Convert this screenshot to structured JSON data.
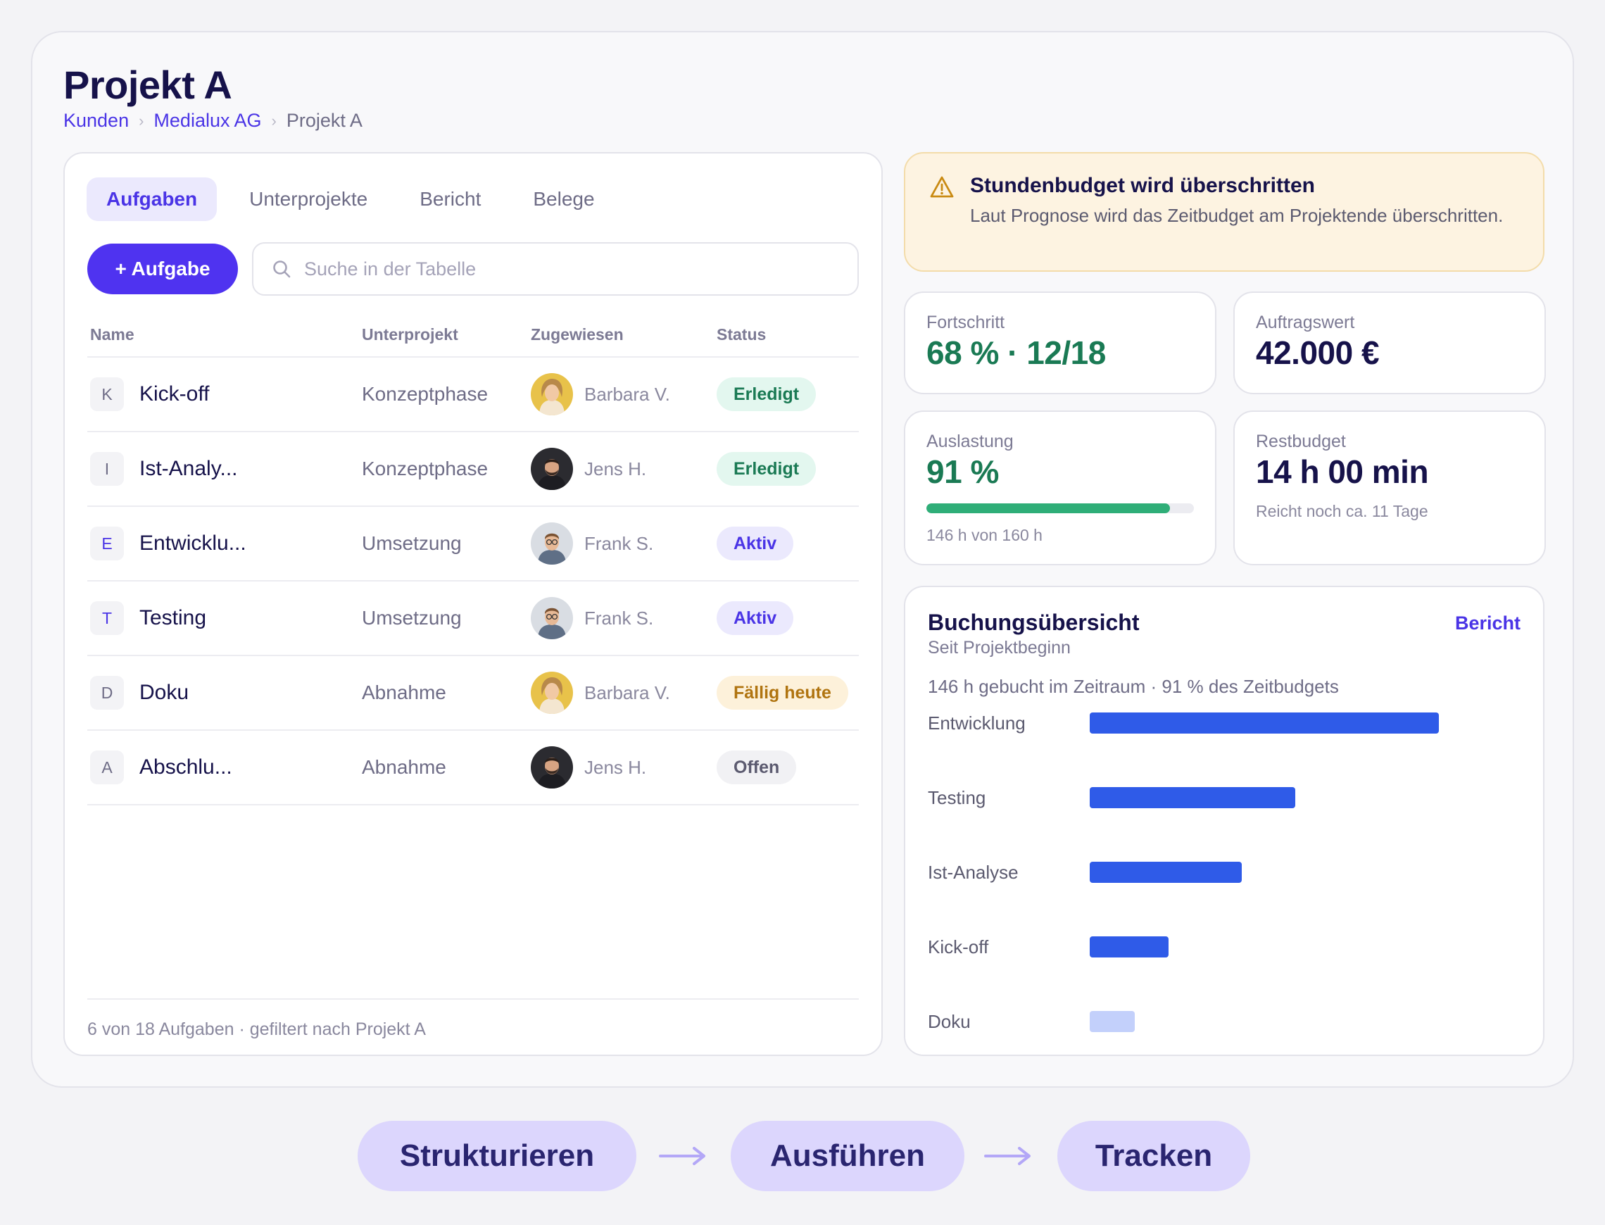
{
  "header": {
    "title": "Projekt A",
    "breadcrumb": [
      "Kunden",
      "Medialux AG",
      "Projekt A"
    ],
    "separator": "›"
  },
  "tabs": [
    "Aufgaben",
    "Unterprojekte",
    "Bericht",
    "Belege"
  ],
  "toolbar": {
    "add_label": "+ Aufgabe",
    "search_placeholder": "Suche in der Tabelle"
  },
  "table": {
    "columns": [
      "Name",
      "Unterprojekt",
      "Zugewiesen",
      "Status"
    ],
    "rows": [
      {
        "initial": "K",
        "name": "Kick-off",
        "subproject": "Konzeptphase",
        "assignee": "Barbara V.",
        "avatar": "barbara-avatar",
        "status": "Erledigt",
        "status_kind": "done"
      },
      {
        "initial": "I",
        "name": "Ist-Analy...",
        "subproject": "Konzeptphase",
        "assignee": "Jens H.",
        "avatar": "jens-avatar",
        "status": "Erledigt",
        "status_kind": "done"
      },
      {
        "initial": "E",
        "name": "Entwicklu...",
        "subproject": "Umsetzung",
        "assignee": "Frank S.",
        "avatar": "frank-avatar",
        "status": "Aktiv",
        "status_kind": "active"
      },
      {
        "initial": "T",
        "name": "Testing",
        "subproject": "Umsetzung",
        "assignee": "Frank S.",
        "avatar": "frank-avatar",
        "status": "Aktiv",
        "status_kind": "active"
      },
      {
        "initial": "D",
        "name": "Doku",
        "subproject": "Abnahme",
        "assignee": "Barbara V.",
        "avatar": "barbara-avatar",
        "status": "Fällig heute",
        "status_kind": "due"
      },
      {
        "initial": "A",
        "name": "Abschlu...",
        "subproject": "Abnahme",
        "assignee": "Jens H.",
        "avatar": "jens-avatar",
        "status": "Offen",
        "status_kind": "open"
      }
    ],
    "footer": "6 von 18 Aufgaben · gefiltert nach Projekt A"
  },
  "alert": {
    "icon": "warning-icon",
    "title": "Stundenbudget wird überschritten",
    "text": "Laut Prognose wird das Zeitbudget am Projektende überschritten."
  },
  "kpis": {
    "progress": {
      "label": "Fortschritt",
      "value": "68 % · 12/18"
    },
    "order_value": {
      "label": "Auftragswert",
      "value": "42.000 €"
    },
    "utilization": {
      "label": "Auslastung",
      "value": "91 %",
      "fill": 0.91,
      "note": "146 h von 160 h"
    },
    "remaining": {
      "label": "Restbudget",
      "value": "14 h 00 min",
      "note": "Reicht noch ca. 11 Tage"
    }
  },
  "booking": {
    "title": "Buchungsübersicht",
    "link": "Bericht",
    "subtitle": "Seit Projektbeginn",
    "summary": "146 h gebucht im Zeitraum · 91 % des Zeitbudgets"
  },
  "chart_data": {
    "type": "bar",
    "orientation": "horizontal",
    "categories": [
      "Entwicklung",
      "Testing",
      "Ist-Analyse",
      "Kick-off",
      "Doku"
    ],
    "values": [
      62,
      36.5,
      27,
      14,
      8
    ],
    "colors": [
      "#2f5be8",
      "#2f5be8",
      "#2f5be8",
      "#2f5be8",
      "#c3d0fb"
    ],
    "xlim": [
      0,
      80
    ]
  },
  "flow": {
    "steps": [
      "Strukturieren",
      "Ausführen",
      "Tracken"
    ],
    "arrow": "→"
  },
  "colors": {
    "accent": "#4f33f0",
    "green": "#1a7a54",
    "navy": "#16124a",
    "bar": "#2f5be8"
  }
}
